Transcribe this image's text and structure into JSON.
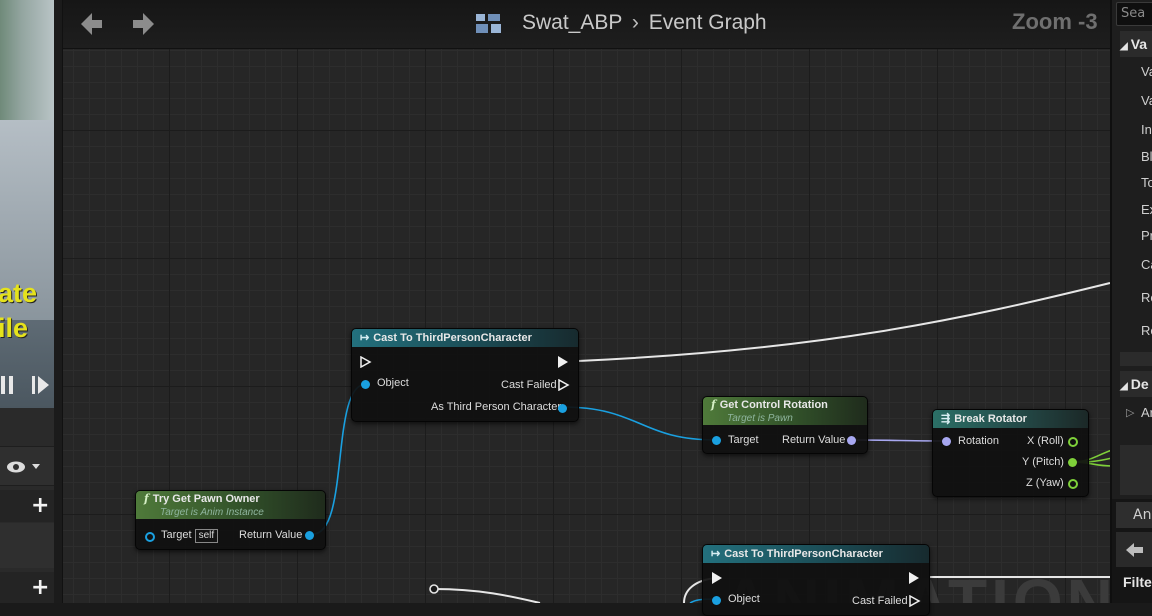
{
  "header": {
    "breadcrumb_asset": "Swat_ABP",
    "breadcrumb_separator": "›",
    "breadcrumb_graph": "Event Graph",
    "zoom": "Zoom -3",
    "back_icon": "arrow-left-icon",
    "forward_icon": "arrow-right-icon"
  },
  "left_panel": {
    "viewport_text_line1": "ate",
    "viewport_text_line2": "ile",
    "pause_icon": "pause-icon",
    "step_icon": "step-forward-icon",
    "eye_icon": "eye-icon",
    "plus_label": "+"
  },
  "graph": {
    "watermark": "ANIMATION",
    "nodes": {
      "cast1": {
        "title": "Cast To ThirdPersonCharacter",
        "pin_object": "Object",
        "pin_cast_failed": "Cast Failed",
        "pin_as": "As Third Person Character"
      },
      "pawn_owner": {
        "title": "Try Get Pawn Owner",
        "subtitle": "Target is Anim Instance",
        "pin_target": "Target",
        "self": "self",
        "pin_return": "Return Value"
      },
      "control_rot": {
        "title": "Get Control Rotation",
        "subtitle": "Target is Pawn",
        "pin_target": "Target",
        "pin_return": "Return Value"
      },
      "break_rot": {
        "title": "Break Rotator",
        "pin_rotation": "Rotation",
        "pin_x": "X (Roll)",
        "pin_y": "Y (Pitch)",
        "pin_z": "Z (Yaw)"
      },
      "cast2": {
        "title": "Cast To ThirdPersonCharacter",
        "pin_object": "Object",
        "pin_cast_failed": "Cast Failed"
      }
    }
  },
  "right_panel": {
    "search_placeholder": "Sea",
    "section1": "Va",
    "items": [
      "Va",
      "Va",
      "In",
      "Bl",
      "To",
      "Ex",
      "Pr",
      "Ca",
      "Re",
      "Re"
    ],
    "section2": "De",
    "section2_item": "Ar",
    "section3": "An",
    "filter": "Filte"
  }
}
